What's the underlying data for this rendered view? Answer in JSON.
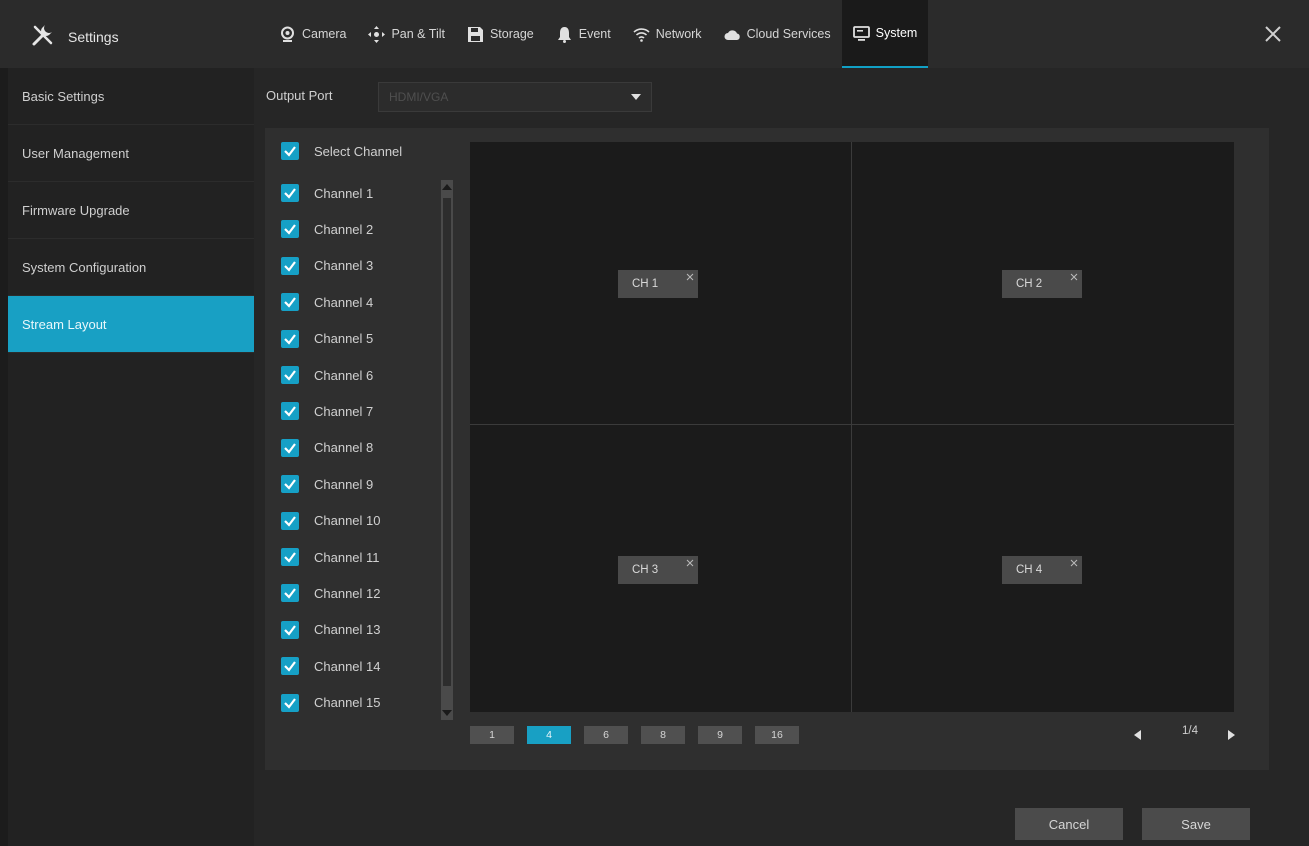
{
  "header": {
    "title": "Settings",
    "close_label": "×",
    "tabs": [
      {
        "label": "Camera",
        "icon": "camera-icon"
      },
      {
        "label": "Pan & Tilt",
        "icon": "pan-tilt-icon"
      },
      {
        "label": "Storage",
        "icon": "storage-icon"
      },
      {
        "label": "Event",
        "icon": "event-icon"
      },
      {
        "label": "Network",
        "icon": "network-icon"
      },
      {
        "label": "Cloud Services",
        "icon": "cloud-icon"
      },
      {
        "label": "System",
        "icon": "system-icon",
        "active": true
      }
    ]
  },
  "sidebar": {
    "items": [
      {
        "label": "Basic Settings"
      },
      {
        "label": "User Management"
      },
      {
        "label": "Firmware Upgrade"
      },
      {
        "label": "System Configuration"
      },
      {
        "label": "Stream Layout",
        "active": true
      }
    ]
  },
  "main": {
    "output_port_label": "Output Port",
    "output_port_value": "HDMI/VGA",
    "select_channel_label": "Select Channel",
    "channels": [
      "Channel 1",
      "Channel 2",
      "Channel 3",
      "Channel 4",
      "Channel 5",
      "Channel 6",
      "Channel 7",
      "Channel 8",
      "Channel 9",
      "Channel 10",
      "Channel 11",
      "Channel 12",
      "Channel 13",
      "Channel 14",
      "Channel 15"
    ],
    "grid_tags": [
      "CH 1",
      "CH 2",
      "CH 3",
      "CH 4"
    ],
    "layout_buttons": [
      {
        "label": "1"
      },
      {
        "label": "4",
        "active": true
      },
      {
        "label": "6"
      },
      {
        "label": "8"
      },
      {
        "label": "9"
      },
      {
        "label": "16"
      }
    ],
    "page_indicator": "1/4"
  },
  "footer": {
    "cancel_label": "Cancel",
    "save_label": "Save"
  },
  "colors": {
    "accent": "#18a0c4",
    "background": "#1c1c1c",
    "panel": "#2f2f2f"
  }
}
